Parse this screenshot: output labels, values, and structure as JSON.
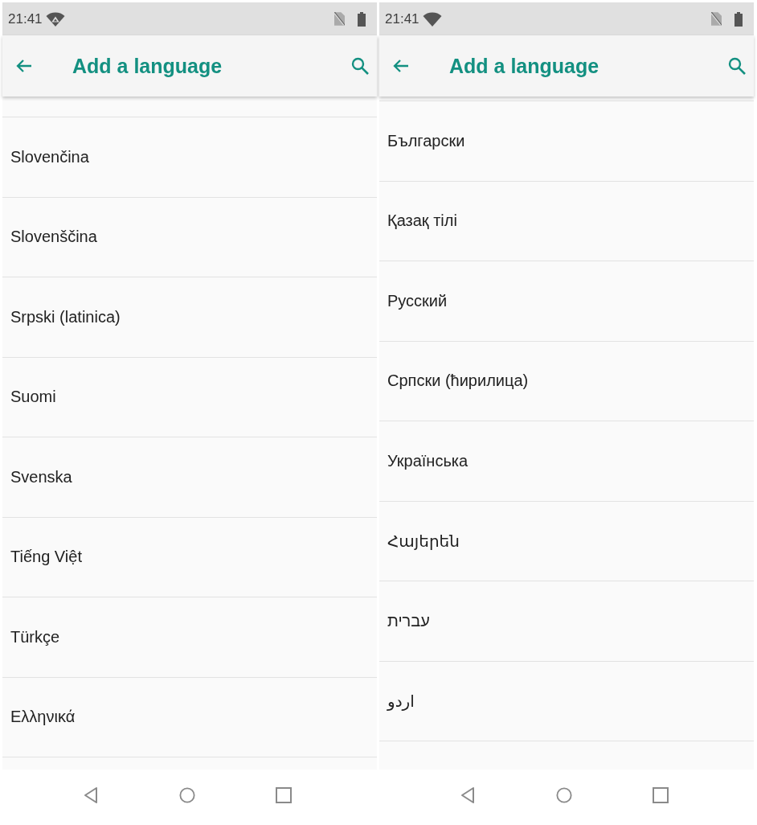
{
  "screens": [
    {
      "status_bar": {
        "time": "21:41",
        "wifi_alert": true
      },
      "app_bar": {
        "title": "Add a language"
      },
      "languages": [
        "Slovenčina",
        "Slovenščina",
        "Srpski (latinica)",
        "Suomi",
        "Svenska",
        "Tiếng Việt",
        "Türkçe",
        "Ελληνικά"
      ]
    },
    {
      "status_bar": {
        "time": "21:41",
        "wifi_alert": false
      },
      "app_bar": {
        "title": "Add a language"
      },
      "languages": [
        "Български",
        "Қазақ тілі",
        "Русский",
        "Српски (ћирилица)",
        "Українська",
        "Հայերեն",
        "עברית",
        "اردو"
      ]
    }
  ]
}
